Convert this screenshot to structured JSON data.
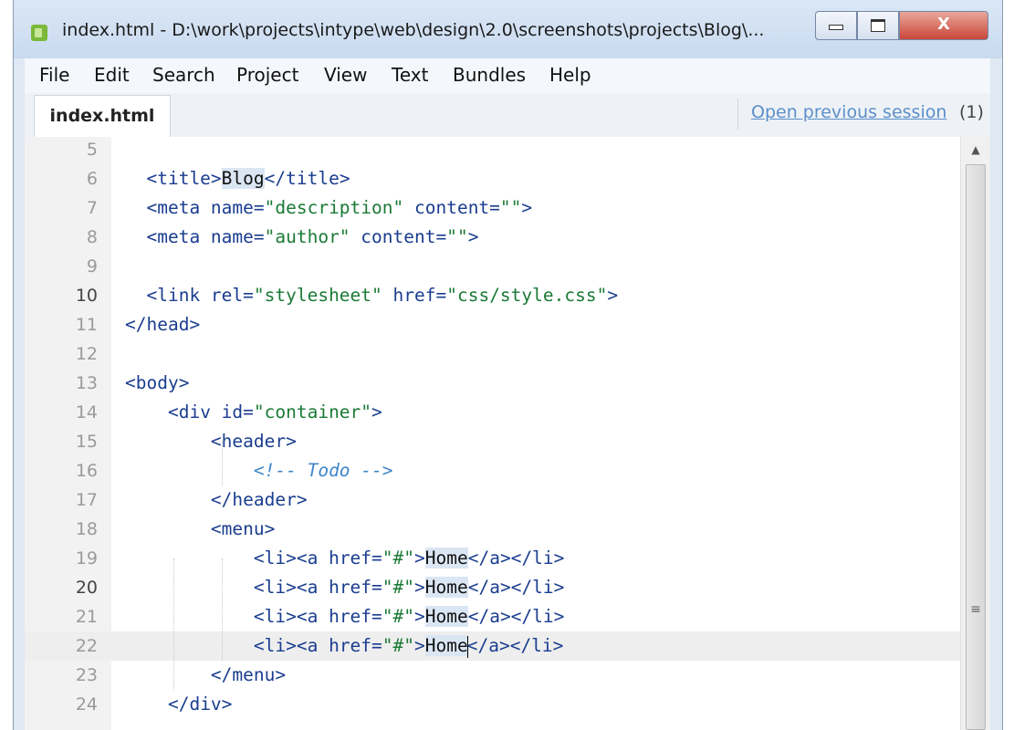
{
  "window": {
    "title": "index.html - D:\\work\\projects\\intype\\web\\design\\2.0\\screenshots\\projects\\Blog\\...",
    "close_label": "X"
  },
  "menu": {
    "items": [
      "File",
      "Edit",
      "Search",
      "Project",
      "View",
      "Text",
      "Bundles",
      "Help"
    ]
  },
  "tabs": {
    "active": "index.html",
    "session_link": "Open previous session",
    "session_count": "(1)"
  },
  "editor": {
    "current_line": 22,
    "lines": [
      {
        "num": "5",
        "text": ""
      },
      {
        "num": "6",
        "text": "  <title>Blog</title>"
      },
      {
        "num": "7",
        "text": "  <meta name=\"description\" content=\"\">"
      },
      {
        "num": "8",
        "text": "  <meta name=\"author\" content=\"\">"
      },
      {
        "num": "9",
        "text": ""
      },
      {
        "num": "10",
        "text": "  <link rel=\"stylesheet\" href=\"css/style.css\">"
      },
      {
        "num": "11",
        "text": "</head>"
      },
      {
        "num": "12",
        "text": ""
      },
      {
        "num": "13",
        "text": "<body>"
      },
      {
        "num": "14",
        "text": "    <div id=\"container\">"
      },
      {
        "num": "15",
        "text": "        <header>"
      },
      {
        "num": "16",
        "text": "            <!-- Todo -->"
      },
      {
        "num": "17",
        "text": "        </header>"
      },
      {
        "num": "18",
        "text": "        <menu>"
      },
      {
        "num": "19",
        "text": "            <li><a href=\"#\">Home</a></li>"
      },
      {
        "num": "20",
        "text": "            <li><a href=\"#\">Home</a></li>"
      },
      {
        "num": "21",
        "text": "            <li><a href=\"#\">Home</a></li>"
      },
      {
        "num": "22",
        "text": "            <li><a href=\"#\">Home</a></li>"
      },
      {
        "num": "23",
        "text": "        </menu>"
      },
      {
        "num": "24",
        "text": "    </div>"
      }
    ]
  },
  "colors": {
    "tag": "#1a3d8f",
    "string": "#1b7a36",
    "comment": "#3f86c8",
    "link": "#5b8fc9",
    "selection": "#dbe6f4"
  },
  "icons": {
    "app": "intype-app-icon",
    "minimize": "minimize-icon",
    "maximize": "maximize-icon",
    "close": "close-icon",
    "scroll_up": "scroll-up-arrow-icon",
    "scroll_grip": "scroll-grip-icon"
  }
}
